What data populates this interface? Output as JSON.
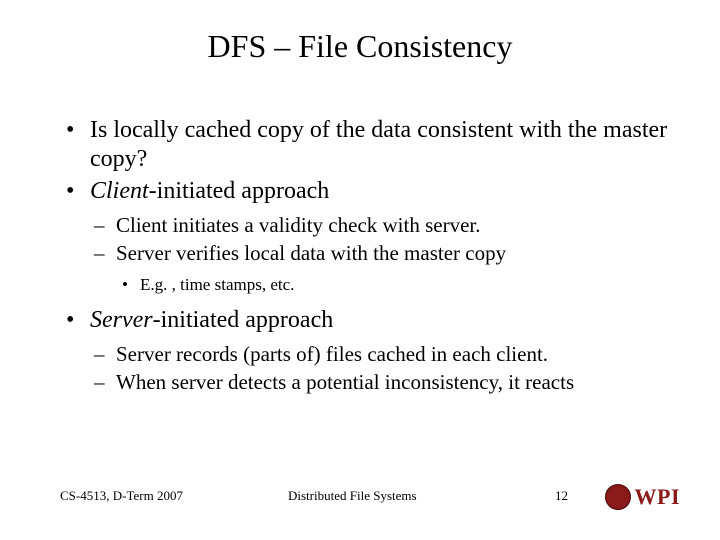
{
  "title": "DFS – File Consistency",
  "bullets": {
    "b1": "Is locally cached copy of the data consistent with the master copy?",
    "b2_em": "Client",
    "b2_rest": "-initiated approach",
    "b2_sub1": "Client initiates a validity check with server.",
    "b2_sub2": "Server verifies local data with the master copy",
    "b2_sub2_sub1": "E.g. , time stamps, etc.",
    "b3_em": "Server",
    "b3_rest": "-initiated approach",
    "b3_sub1": "Server records (parts of) files cached in each client.",
    "b3_sub2": "When server detects a potential inconsistency, it reacts"
  },
  "footer": {
    "left": "CS-4513, D-Term 2007",
    "center": "Distributed File Systems",
    "page": "12",
    "logo_text": "WPI"
  }
}
